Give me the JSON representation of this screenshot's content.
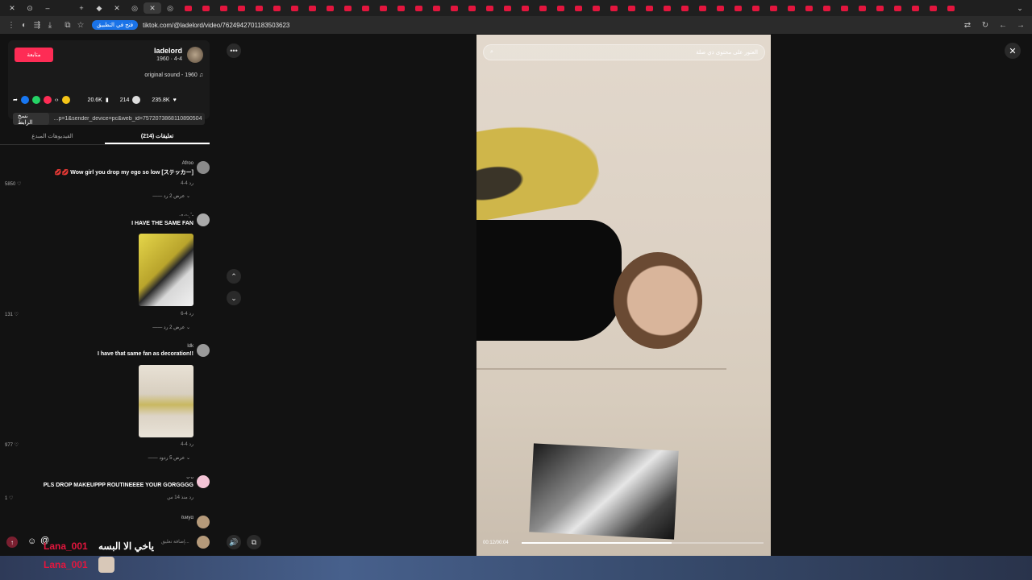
{
  "browser": {
    "url": "tiktok.com/@ladelord/video/7624942701183503623",
    "open_in_app": "فتح في التطبيق",
    "tab_active_symbol": "✕"
  },
  "post": {
    "follow_label": "متابعة",
    "username": "ladelord",
    "date": "1960 · 4-4",
    "sound": "original sound - 1960",
    "likes": "235.8K",
    "comments": "214",
    "bookmarks": "20.6K",
    "copy_link_label": "نسخ الرابط",
    "link_text": "...p=1&sender_device=pc&web_id=7572073868110890504"
  },
  "panel_tabs": {
    "comments": "(214) تعليقات",
    "creator_videos": "الفيديوهات المبدع"
  },
  "comments": [
    {
      "name": "Afroo",
      "text": "💋💋 Wow girl you drop my ego so low [ステッカー]",
      "meta": "رد   4-4",
      "likes": "5850 ♡",
      "replies": "—— عرض 2 رد ⌄"
    },
    {
      "name": "·⍤·ᵕ·ˎˊ˗",
      "text": "I HAVE THE SAME FAN",
      "meta": "رد   4-6",
      "likes": "131 ♡",
      "replies": "—— عرض 2 رد ⌄"
    },
    {
      "name": "ldk",
      "text": "I have that same fan as decoration!!",
      "meta": "رد   4-4",
      "likes": "977 ♡",
      "replies": "—— عرض 5 ردود ⌄"
    },
    {
      "name": "ᴗ·ᴗ",
      "text": "PLS DROP MAKEUPPP ROUTINEEEE YOUR GORGGGG",
      "meta": "رد   منذ 14 س",
      "likes": "1 ♡",
      "replies": ""
    },
    {
      "name": "ℓυиуα",
      "text": "",
      "meta": "",
      "likes": "",
      "replies": ""
    }
  ],
  "add_comment_placeholder": "إضافة تعليق...",
  "video": {
    "search_placeholder": "العثور على محتوى ذي صلة",
    "time": "00:12/00:04",
    "progress": 0.62
  },
  "stream_overlay": {
    "line1_name": "Lana_001",
    "line1_msg": "ياخي الا البسه",
    "line2_name": "Lana_001"
  },
  "colors": {
    "accent": "#fe2c55",
    "background": "#121212"
  }
}
